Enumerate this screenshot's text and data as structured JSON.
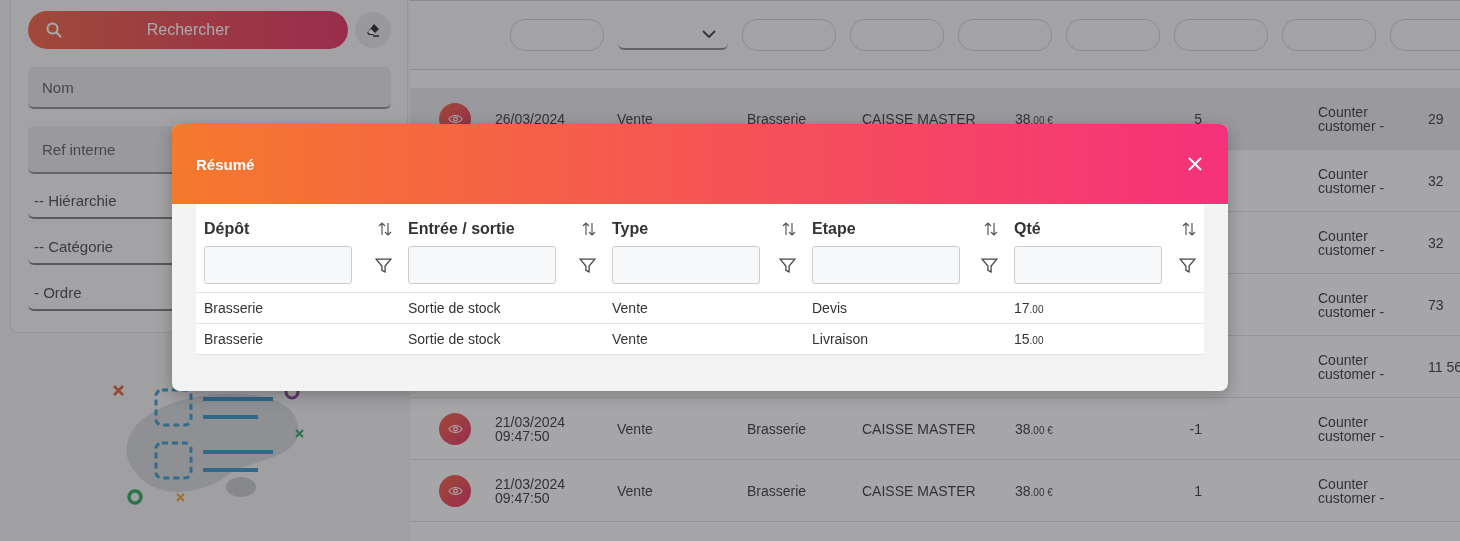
{
  "sidebar": {
    "search_button": "Rechercher",
    "filters": [
      {
        "kind": "input",
        "placeholder": "Nom"
      },
      {
        "kind": "input",
        "placeholder": "Ref interne"
      },
      {
        "kind": "select",
        "placeholder": "-- Hiérarchie"
      },
      {
        "kind": "select",
        "placeholder": "-- Catégorie"
      },
      {
        "kind": "select",
        "placeholder": "- Ordre"
      }
    ]
  },
  "header_filters": [
    {
      "kind": "field"
    },
    {
      "kind": "select"
    },
    {
      "kind": "field"
    },
    {
      "kind": "field"
    },
    {
      "kind": "field"
    },
    {
      "kind": "field"
    },
    {
      "kind": "field"
    },
    {
      "kind": "field"
    },
    {
      "kind": "field"
    }
  ],
  "table": {
    "rows": [
      {
        "view": true,
        "date": "26/03/2024",
        "type": "Vente",
        "depot": "Brasserie",
        "caisse": "CAISSE MASTER",
        "amount": "38",
        "amount_decimals": ".00 €",
        "qty": "5",
        "customer": "Counter customer -",
        "column_10": "29"
      },
      {
        "customer": "Counter customer -",
        "column_10": "32"
      },
      {
        "customer": "Counter customer -",
        "column_10": "32"
      },
      {
        "customer": "Counter customer -",
        "column_10": "73"
      },
      {
        "customer": "Counter customer -",
        "column_10": "11 56"
      },
      {
        "view": true,
        "date": "21/03/2024",
        "time": "09:47:50",
        "type": "Vente",
        "depot": "Brasserie",
        "caisse": "CAISSE MASTER",
        "amount": "38",
        "amount_decimals": ".00 €",
        "qty": "-1",
        "customer": "Counter customer -"
      },
      {
        "view": true,
        "date": "21/03/2024",
        "time": "09:47:50",
        "type": "Vente",
        "depot": "Brasserie",
        "caisse": "CAISSE MASTER",
        "amount": "38",
        "amount_decimals": ".00 €",
        "qty": "1",
        "customer": "Counter customer -"
      }
    ]
  },
  "modal": {
    "title": "Résumé",
    "columns": [
      "Dépôt",
      "Entrée / sortie",
      "Type",
      "Etape",
      "Qté"
    ],
    "rows": [
      {
        "cells": [
          "Brasserie",
          "Sortie de stock",
          "Vente",
          "Devis"
        ],
        "qty": "17",
        "qty_decimals": ".00"
      },
      {
        "cells": [
          "Brasserie",
          "Sortie de stock",
          "Vente",
          "Livraison"
        ],
        "qty": "15",
        "qty_decimals": ".00"
      }
    ]
  }
}
